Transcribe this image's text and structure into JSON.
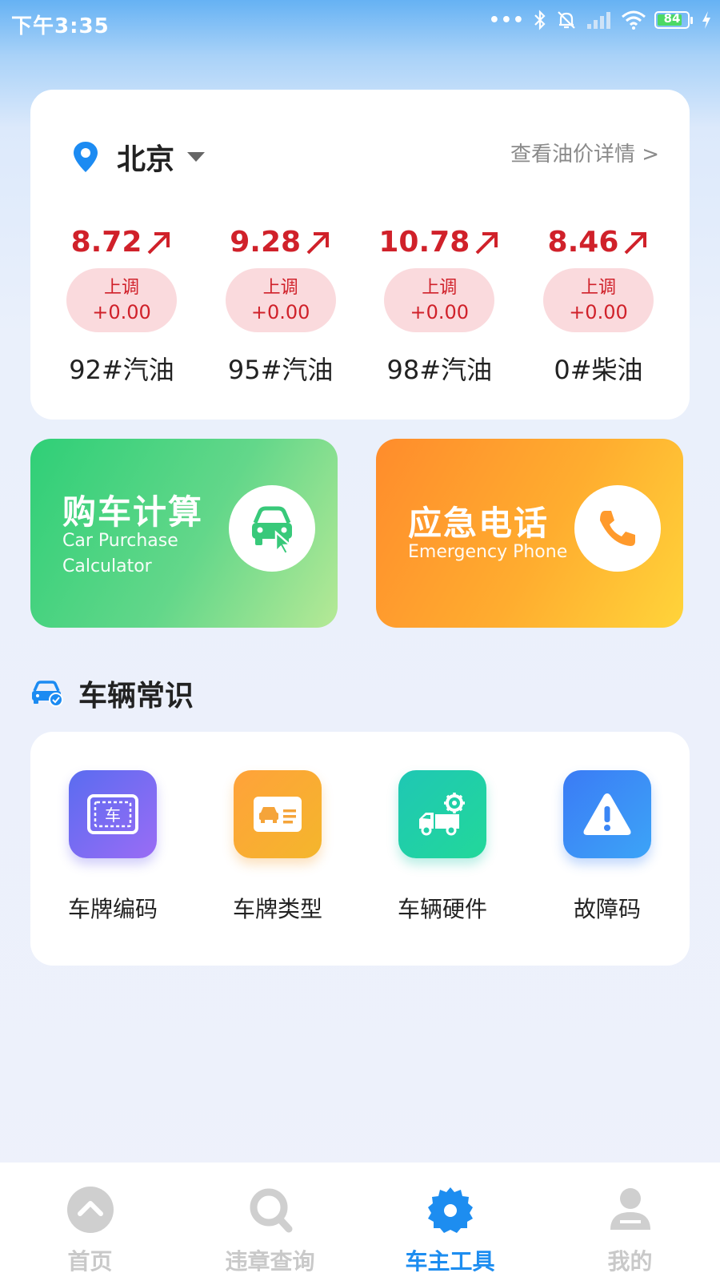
{
  "status_bar": {
    "time": "下午3:35",
    "battery": "84",
    "battery_level": 0.84
  },
  "fuel": {
    "city": "北京",
    "details_link": "查看油价详情 >",
    "items": [
      {
        "price": "8.72",
        "change_dir": "上调",
        "change": "+0.00",
        "name": "92#汽油"
      },
      {
        "price": "9.28",
        "change_dir": "上调",
        "change": "+0.00",
        "name": "95#汽油"
      },
      {
        "price": "10.78",
        "change_dir": "上调",
        "change": "+0.00",
        "name": "98#汽油"
      },
      {
        "price": "8.46",
        "change_dir": "上调",
        "change": "+0.00",
        "name": "0#柴油"
      }
    ]
  },
  "tools": {
    "calculator": {
      "title": "购车计算",
      "subtitle_line1": "Car Purchase",
      "subtitle_line2": "Calculator"
    },
    "emergency": {
      "title": "应急电话",
      "subtitle": "Emergency Phone"
    }
  },
  "knowledge": {
    "title": "车辆常识",
    "items": [
      {
        "label": "车牌编码",
        "icon_text": "车"
      },
      {
        "label": "车牌类型"
      },
      {
        "label": "车辆硬件"
      },
      {
        "label": "故障码"
      }
    ]
  },
  "nav": {
    "items": [
      {
        "label": "首页"
      },
      {
        "label": "违章查询"
      },
      {
        "label": "车主工具"
      },
      {
        "label": "我的"
      }
    ]
  },
  "colors": {
    "price_red": "#d0212a",
    "pill_pink": "#fadadd",
    "active_blue": "#1d8df0",
    "inactive_gray": "#c9c9c9"
  }
}
